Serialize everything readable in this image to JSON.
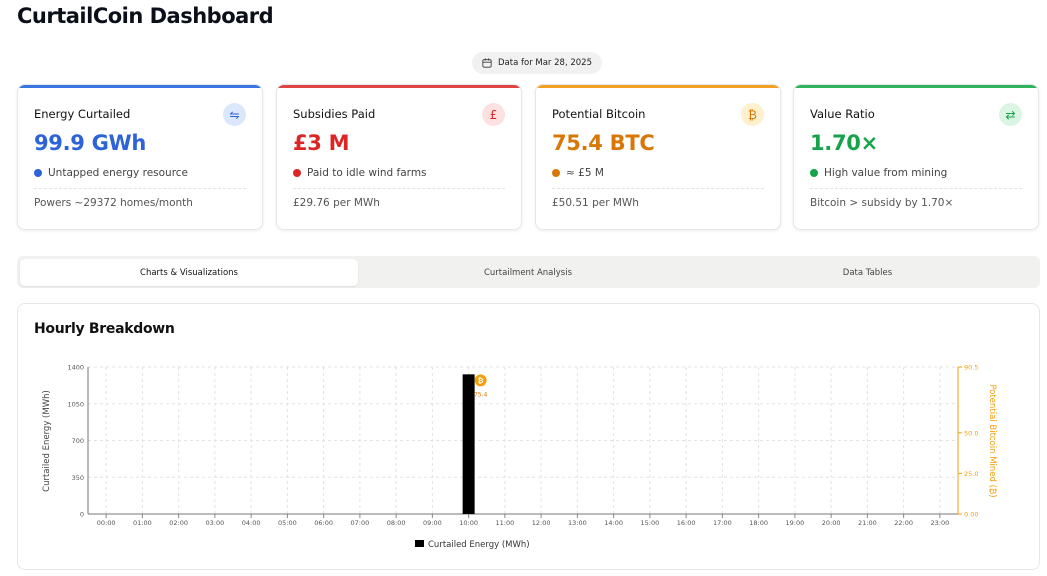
{
  "header": {
    "title": "CurtailCoin Dashboard"
  },
  "date_pill": {
    "label": "Data for Mar 28, 2025"
  },
  "cards": [
    {
      "label": "Energy Curtailed",
      "icon": "energy-flow-icon",
      "icon_glyph": "⇋",
      "accent": "#3b76e0",
      "icon_bg": "#dbe7fb",
      "value": "99.9 GWh",
      "value_color": "#2c63d8",
      "dot_color": "#2c63d8",
      "sub": "Untapped energy resource",
      "foot": "Powers ~29372 homes/month"
    },
    {
      "label": "Subsidies Paid",
      "icon": "pound-icon",
      "icon_glyph": "£",
      "accent": "#e04545",
      "icon_bg": "#fde1e1",
      "value": "£3 M",
      "value_color": "#dc2626",
      "dot_color": "#dc2626",
      "sub": "Paid to idle wind farms",
      "foot": "£29.76 per MWh"
    },
    {
      "label": "Potential Bitcoin",
      "icon": "bitcoin-icon",
      "icon_glyph": "₿",
      "accent": "#f2a024",
      "icon_bg": "#fdf0cc",
      "value": "75.4 BTC",
      "value_color": "#d97706",
      "dot_color": "#d97706",
      "sub": "≈ £5 M",
      "foot": "£50.51 per MWh"
    },
    {
      "label": "Value Ratio",
      "icon": "swap-arrows-icon",
      "icon_glyph": "⇄",
      "accent": "#30b35a",
      "icon_bg": "#dcf5e3",
      "value": "1.70×",
      "value_color": "#16a34a",
      "dot_color": "#16a34a",
      "sub": "High value from mining",
      "foot": "Bitcoin > subsidy by 1.70×"
    }
  ],
  "tabs": [
    {
      "label": "Charts & Visualizations",
      "active": true
    },
    {
      "label": "Curtailment Analysis",
      "active": false
    },
    {
      "label": "Data Tables",
      "active": false
    }
  ],
  "chart_panel": {
    "title": "Hourly Breakdown"
  },
  "chart_data": {
    "type": "bar",
    "categories": [
      "00:00",
      "01:00",
      "02:00",
      "03:00",
      "04:00",
      "05:00",
      "06:00",
      "07:00",
      "08:00",
      "09:00",
      "10:00",
      "11:00",
      "12:00",
      "13:00",
      "14:00",
      "15:00",
      "16:00",
      "17:00",
      "18:00",
      "19:00",
      "20:00",
      "21:00",
      "22:00",
      "23:00"
    ],
    "series": [
      {
        "name": "Curtailed Energy (MWh)",
        "color": "#000000",
        "values": [
          0,
          0,
          0,
          0,
          0,
          0,
          0,
          0,
          0,
          0,
          1330,
          0,
          0,
          0,
          0,
          0,
          0,
          0,
          0,
          0,
          0,
          0,
          0,
          0
        ]
      }
    ],
    "bitcoin_markers": [
      {
        "category": "10:00",
        "value": 75.4,
        "label": "75.4"
      }
    ],
    "ylabel_left": "Curtailed Energy (MWh)",
    "ylabel_right": "Potential Bitcoin Mined (₿)",
    "ylim_left": [
      0,
      1400
    ],
    "yticks_left": [
      "0",
      "350",
      "700",
      "1050",
      "1400"
    ],
    "ylim_right": [
      0,
      90.5
    ],
    "yticks_right": [
      "0.00",
      "25.0",
      "50.0",
      "90.5"
    ],
    "yticks_right_values": [
      0,
      25,
      50,
      90.5
    ],
    "right_axis_color": "#f59e0b",
    "grid": true,
    "legend": "bottom"
  }
}
